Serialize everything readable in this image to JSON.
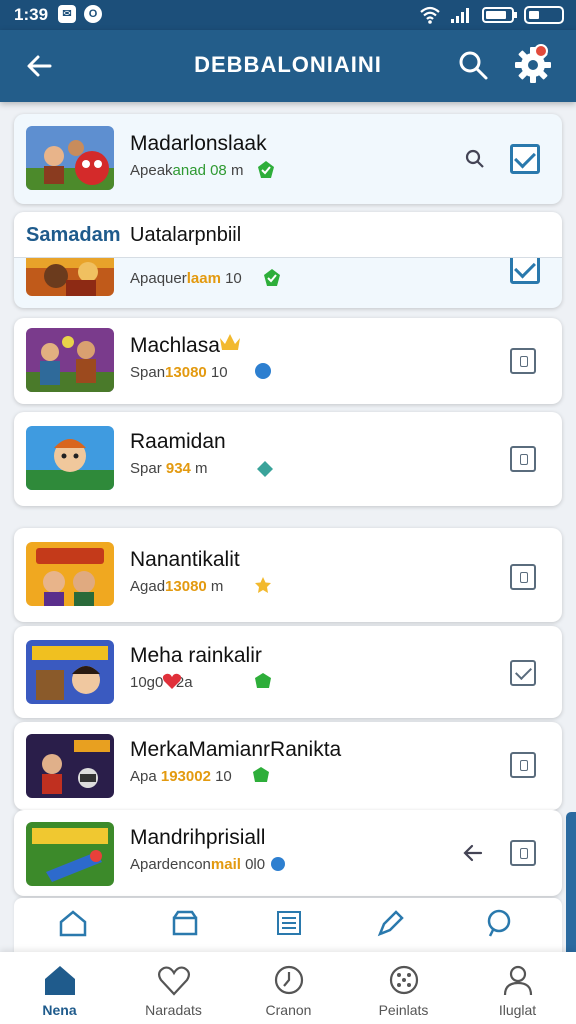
{
  "status": {
    "time": "1:39",
    "app1": "✉",
    "app2": "O"
  },
  "appbar": {
    "title": "DEBBALONIAINI"
  },
  "overlay": {
    "key": "Samadam",
    "value": "Uatalarpnbiil"
  },
  "games": [
    {
      "title": "Madarlonslaak",
      "sub_a": "Apeak",
      "sub_hl": "anad 08",
      "sub_b": " m",
      "state": "selected"
    },
    {
      "title": "",
      "sub_a": "Apaquer",
      "sub_hl": "laam",
      "sub_b": " 10",
      "state": "selected"
    },
    {
      "title": "Machlasa",
      "sub_a": "Span",
      "sub_hl": "13080",
      "sub_b": " 10",
      "state": "box"
    },
    {
      "title": "Raamidan",
      "sub_a": "Spar ",
      "sub_hl": "934",
      "sub_b": " m",
      "state": "box"
    },
    {
      "title": "Nanantikalit",
      "sub_a": "Agad",
      "sub_hl": "13080",
      "sub_b": " m",
      "state": "box"
    },
    {
      "title": "Meha  rainkalir",
      "sub_a": "10g0 ",
      "sub_hl": "",
      "sub_b": " 62a",
      "state": "tick"
    },
    {
      "title": "MerkaMamianrRanikta",
      "sub_a": "Apa ",
      "sub_hl": "193002",
      "sub_b": " 10",
      "state": "box"
    },
    {
      "title": "Mandrihprisiall",
      "sub_a": "Apardencon",
      "sub_hl": "mail",
      "sub_b": " 0l0",
      "state": "box"
    }
  ],
  "tabs": [
    {
      "label": "Nena",
      "icon": "home-icon"
    },
    {
      "label": "Naradats",
      "icon": "heart-icon"
    },
    {
      "label": "Cranon",
      "icon": "clock-icon"
    },
    {
      "label": "Peinlats",
      "icon": "dice-icon"
    },
    {
      "label": "Iluglat",
      "icon": "profile-icon"
    }
  ],
  "colors": {
    "appbar": "#235d8a",
    "statusbar": "#1c4f7a",
    "accent": "#2a79ad",
    "highlight": "#e39a10"
  }
}
